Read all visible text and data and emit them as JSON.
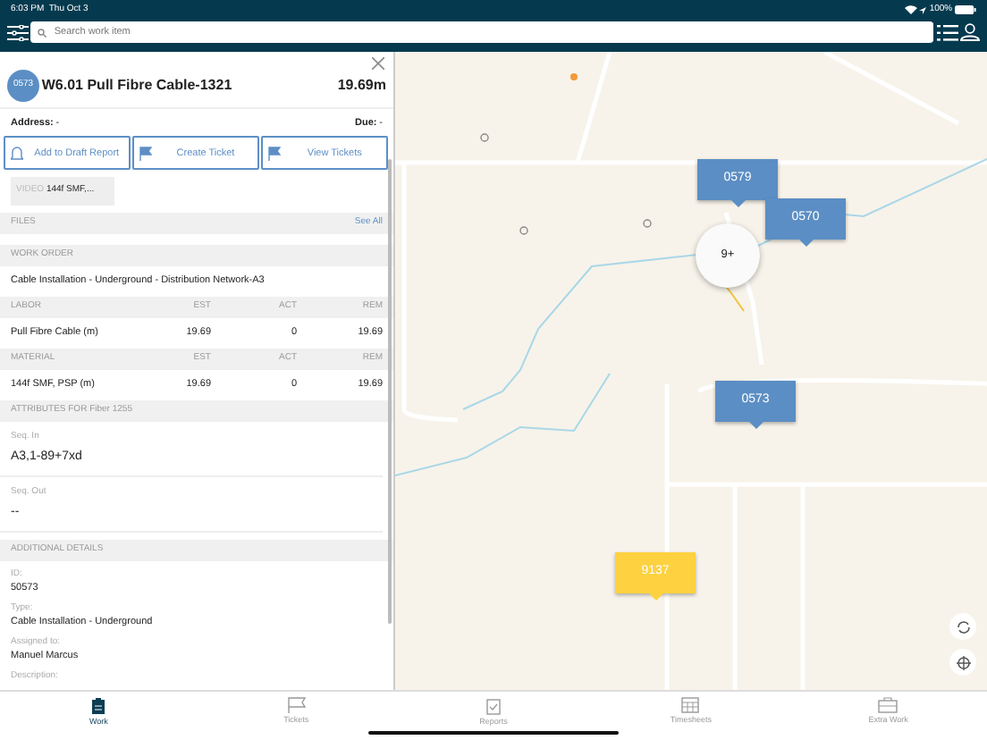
{
  "status_bar": {
    "time": "6:03 PM",
    "date": "Thu Oct 3",
    "battery": "100%"
  },
  "search": {
    "placeholder": "Search work item"
  },
  "detail": {
    "badge": "0573",
    "title": "W6.01 Pull Fibre Cable-1321",
    "length": "19.69m",
    "address_label": "Address:",
    "address_value": "-",
    "due_label": "Due:",
    "due_value": "-",
    "actions": [
      {
        "label": "Add to Draft Report",
        "kind": "report"
      },
      {
        "label": "Create Ticket",
        "kind": "flag"
      },
      {
        "label": "View Tickets",
        "kind": "flag"
      }
    ],
    "attachment": {
      "type": "VIDEO",
      "name": "144f SMF,..."
    },
    "files": {
      "header": "FILES",
      "link": "See All"
    },
    "work_order": {
      "header": "WORK ORDER",
      "value": "Cable Installation - Underground - Distribution Network-A3"
    },
    "tables": [
      {
        "columns": [
          "LABOR",
          "EST",
          "ACT",
          "REM"
        ],
        "rows": [
          [
            "Pull Fibre Cable (m)",
            "19.69",
            "0",
            "19.69"
          ]
        ]
      },
      {
        "columns": [
          "MATERIAL",
          "EST",
          "ACT",
          "REM"
        ],
        "rows": [
          [
            "144f SMF, PSP (m)",
            "19.69",
            "0",
            "19.69"
          ]
        ]
      }
    ],
    "attributes": {
      "header": "ATTRIBUTES FOR Fiber 1255",
      "fields": [
        {
          "label": "Seq. In",
          "value": "A3,1-89+7xd"
        },
        {
          "label": "Seq. Out",
          "value": "--"
        }
      ]
    },
    "additional": {
      "header": "ADDITIONAL DETAILS",
      "fields": [
        {
          "label": "ID:",
          "value": "50573"
        },
        {
          "label": "Type:",
          "value": "Cable Installation - Underground"
        },
        {
          "label": "Assigned to:",
          "value": "Manuel Marcus"
        },
        {
          "label": "Description:"
        }
      ]
    }
  },
  "map": {
    "markers": [
      {
        "label": "0579",
        "kind": "tag",
        "color": "#5b8ec4"
      },
      {
        "label": "0570",
        "kind": "tag",
        "color": "#5b8ec4"
      },
      {
        "label": "9+",
        "kind": "cluster"
      },
      {
        "label": "0573",
        "kind": "tag",
        "color": "#5b8ec4"
      },
      {
        "label": "9137",
        "kind": "tag",
        "color": "#fdd140"
      }
    ]
  },
  "tab_bar": [
    {
      "label": "Work",
      "selected": true
    },
    {
      "label": "Tickets",
      "selected": false
    },
    {
      "label": "Reports",
      "selected": false
    },
    {
      "label": "Timesheets",
      "selected": false
    },
    {
      "label": "Extra Work",
      "selected": false
    }
  ]
}
